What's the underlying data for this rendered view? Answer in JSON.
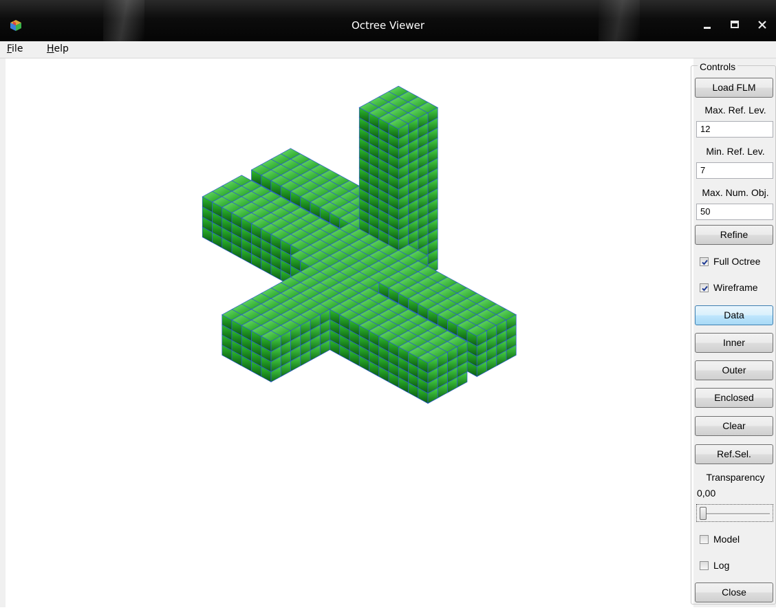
{
  "window": {
    "title": "Octree Viewer",
    "icon": "octree-cube-icon",
    "controls": [
      "minimize-icon",
      "maximize-icon",
      "close-icon"
    ]
  },
  "menu": {
    "file": {
      "accel": "F",
      "rest": "ile"
    },
    "help": {
      "accel": "H",
      "rest": "elp"
    }
  },
  "viewport": {
    "content": "3D voxel octree rendering of a hand-like model",
    "voxel_color": "#1faa1f",
    "wire_color": "#2a5ad0"
  },
  "controls": {
    "group_title": "Controls",
    "load_flm": "Load FLM",
    "max_ref_lev_label": "Max. Ref. Lev.",
    "max_ref_lev_value": "12",
    "min_ref_lev_label": "Min. Ref. Lev.",
    "min_ref_lev_value": "7",
    "max_num_obj_label": "Max. Num. Obj.",
    "max_num_obj_value": "50",
    "refine": "Refine",
    "full_octree": {
      "label": "Full Octree",
      "checked": true
    },
    "wireframe": {
      "label": "Wireframe",
      "checked": true
    },
    "data": "Data",
    "inner": "Inner",
    "outer": "Outer",
    "enclosed": "Enclosed",
    "clear": "Clear",
    "ref_sel": "Ref.Sel.",
    "transparency_label": "Transparency",
    "transparency_value": "0,00",
    "transparency_level": 0.0,
    "model": {
      "label": "Model",
      "checked": false
    },
    "log": {
      "label": "Log",
      "checked": false
    },
    "close": "Close"
  }
}
